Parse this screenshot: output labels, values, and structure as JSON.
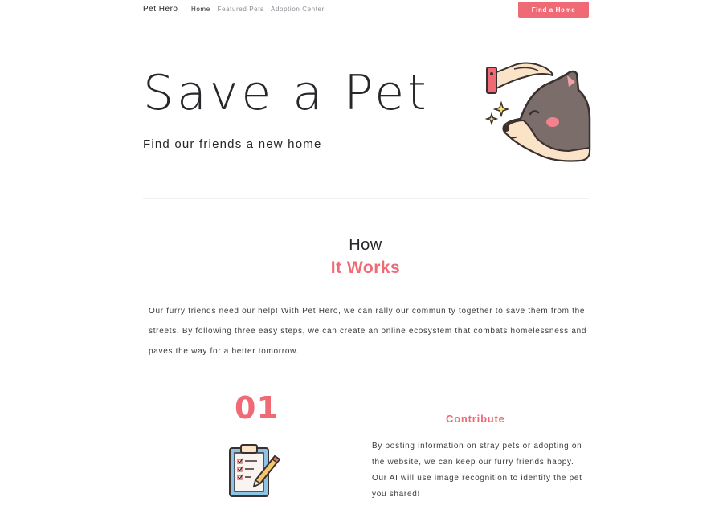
{
  "nav": {
    "brand": "Pet Hero",
    "links": [
      "Home",
      "Featured Pets",
      "Adoption Center"
    ],
    "cta": "Find a Home"
  },
  "hero": {
    "title": "Save a Pet",
    "subtitle": "Find our friends a new home"
  },
  "how": {
    "line1": "How",
    "line2": "It Works",
    "intro": "Our furry friends need our help! With Pet Hero, we can rally our community together to save them from the streets. By following three easy steps, we can create an online ecosystem that combats homelessness and paves the way for a better tomorrow."
  },
  "steps": [
    {
      "number": "01",
      "title": "Contribute",
      "description": "By posting information on stray pets or adopting on the website, we can keep our furry friends happy. Our AI will use image recognition to identify the pet you shared!"
    }
  ],
  "colors": {
    "accent": "#f06a76",
    "text": "#26262b"
  },
  "icons": {
    "hero": "hand-petting-dog-icon",
    "step": "clipboard-checklist-icon"
  }
}
